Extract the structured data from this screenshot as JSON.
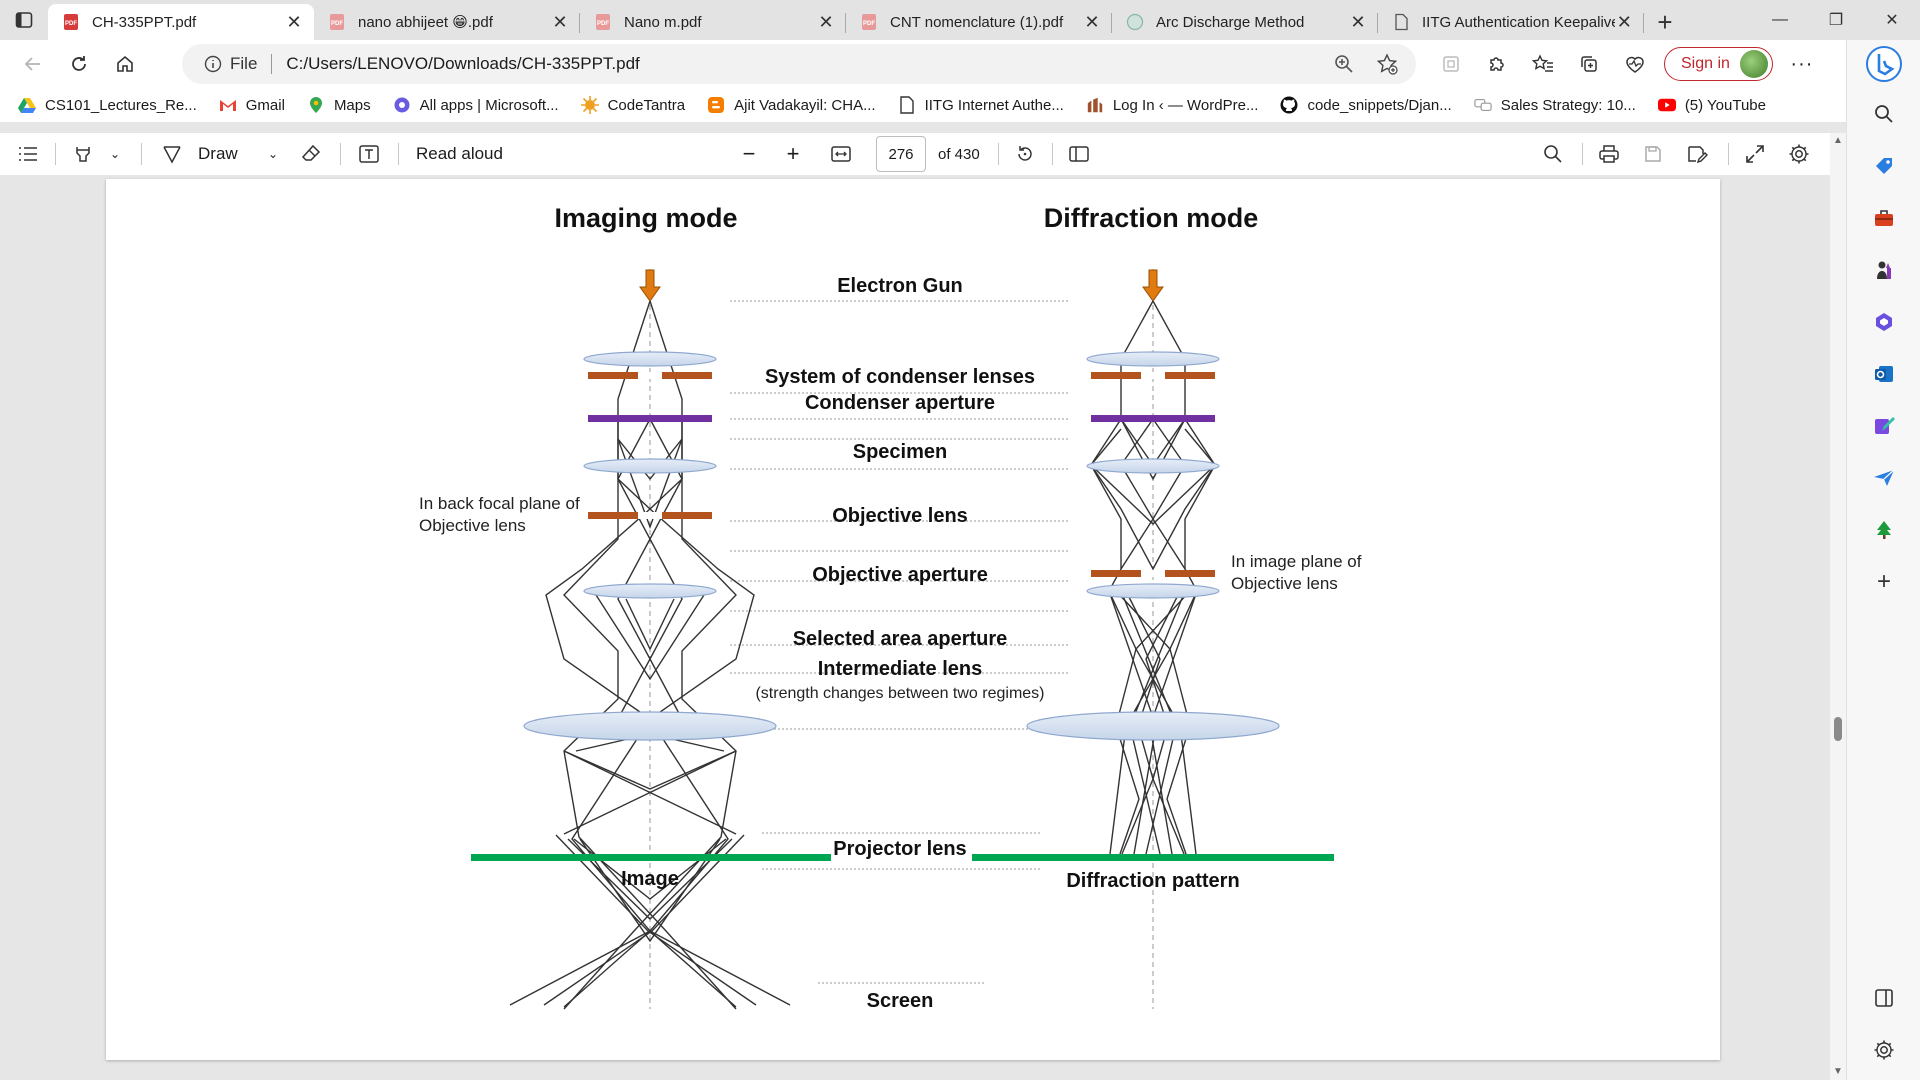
{
  "browser": {
    "tabs": [
      {
        "title": "CH-335PPT.pdf",
        "icon": "pdf-icon",
        "active": true
      },
      {
        "title": "nano abhijeet 😁.pdf",
        "icon": "pdf-icon",
        "active": false
      },
      {
        "title": "Nano m.pdf",
        "icon": "pdf-icon",
        "active": false
      },
      {
        "title": "CNT nomenclature (1).pdf",
        "icon": "pdf-icon",
        "active": false
      },
      {
        "title": "Arc Discharge Method",
        "icon": "globe-icon",
        "active": false
      },
      {
        "title": "IITG Authentication Keepalive",
        "icon": "document-icon",
        "active": false
      }
    ],
    "address": {
      "site_label": "File",
      "url": "C:/Users/LENOVO/Downloads/CH-335PPT.pdf"
    },
    "sign_in_label": "Sign in",
    "bookmarks": [
      {
        "label": "CS101_Lectures_Re...",
        "icon": "google-drive-icon"
      },
      {
        "label": "Gmail",
        "icon": "gmail-icon"
      },
      {
        "label": "Maps",
        "icon": "maps-pin-icon"
      },
      {
        "label": "All apps | Microsoft...",
        "icon": "microsoft-apps-icon"
      },
      {
        "label": "CodeTantra",
        "icon": "codetantra-icon"
      },
      {
        "label": "Ajit Vadakayil: CHA...",
        "icon": "blogger-icon"
      },
      {
        "label": "IITG Internet Authe...",
        "icon": "document-icon"
      },
      {
        "label": "Log In ‹ — WordPre...",
        "icon": "wordpress-icon"
      },
      {
        "label": "code_snippets/Djan...",
        "icon": "github-icon"
      },
      {
        "label": "Sales Strategy: 10...",
        "icon": "chat-bubbles-icon"
      },
      {
        "label": "(5) YouTube",
        "icon": "youtube-icon"
      }
    ]
  },
  "pdf_toolbar": {
    "draw_label": "Draw",
    "read_aloud_label": "Read aloud",
    "current_page": "276",
    "page_total": "of 430"
  },
  "slide": {
    "imaging_title": "Imaging mode",
    "diffraction_title": "Diffraction mode",
    "components": {
      "electron_gun": "Electron Gun",
      "condenser_lenses": "System of condenser lenses",
      "condenser_aperture": "Condenser aperture",
      "specimen": "Specimen",
      "objective_lens": "Objective lens",
      "objective_aperture": "Objective aperture",
      "selected_area_aperture": "Selected area aperture",
      "intermediate_lens": "Intermediate lens",
      "intermediate_note": "(strength changes between two regimes)",
      "projector_lens": "Projector lens",
      "screen": "Screen"
    },
    "left_note": [
      "In back focal plane of",
      "Objective lens"
    ],
    "right_note": [
      "In image plane of",
      "Objective lens"
    ],
    "image_caption": "Image",
    "diffraction_caption": "Diffraction pattern",
    "colors": {
      "lens_fill": "#d6e1f0",
      "lens_stroke": "#8fa8cf",
      "aperture": "#b3541e",
      "specimen": "#7030a0",
      "screen": "#00a651",
      "gun_arrow": "#e07b12"
    }
  }
}
